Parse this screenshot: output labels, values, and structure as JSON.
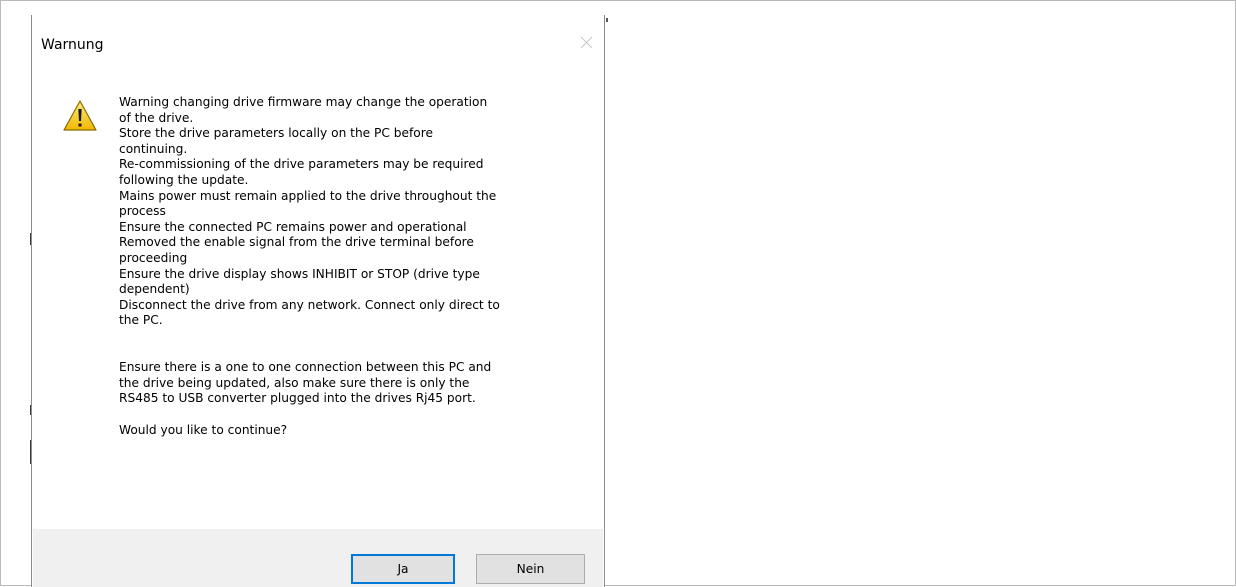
{
  "dialog": {
    "title": "Warnung",
    "close_icon": "close-icon",
    "warning_icon": "warning-triangle-icon",
    "message_lines": [
      "Warning changing drive firmware may change the operation",
      "of the drive.",
      "Store the drive parameters locally on the PC before",
      "continuing.",
      "Re-commissioning of the drive parameters may be required",
      "following the update.",
      "Mains power must remain applied to the drive throughout the",
      "process",
      "Ensure the connected PC remains power and operational",
      "Removed the enable signal from the drive terminal before",
      "proceeding",
      "Ensure the drive display shows INHIBIT or STOP (drive type",
      "dependent)",
      "Disconnect the drive from any network. Connect only direct to",
      "the PC."
    ],
    "connection_lines": [
      "Ensure there is a one to one connection between this PC and",
      "the drive being updated, also make sure there is only the",
      "RS485 to USB converter plugged into the drives Rj45 port."
    ],
    "question": "Would you like to continue?",
    "buttons": {
      "yes_label": "Ja",
      "no_label": "Nein"
    },
    "colors": {
      "accent": "#0078d7",
      "footer_bg": "#f0f0f0",
      "button_bg": "#e1e1e1",
      "warning_yellow": "#f5c518"
    }
  }
}
